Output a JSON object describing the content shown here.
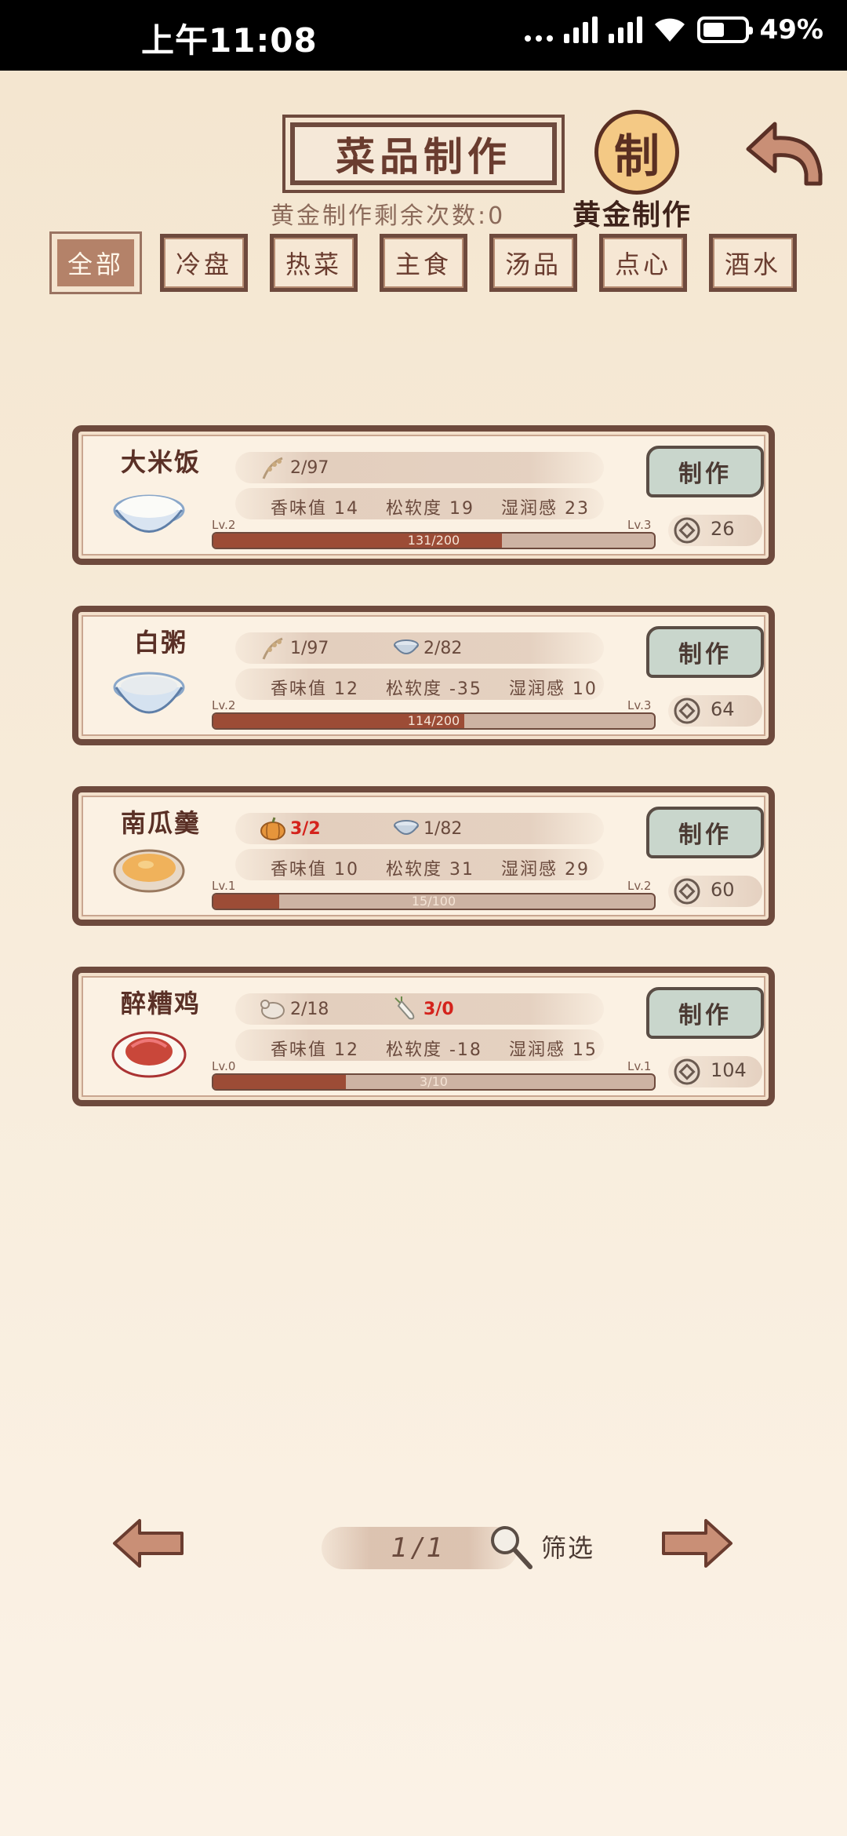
{
  "status": {
    "time": "上午11:08",
    "battery": "49%"
  },
  "header": {
    "title": "菜品制作",
    "gold_remaining": "黄金制作剩余次数:0",
    "gold_seal_char": "制",
    "gold_label": "黄金制作"
  },
  "tabs": [
    {
      "label": "全部",
      "active": true
    },
    {
      "label": "冷盘",
      "active": false
    },
    {
      "label": "热菜",
      "active": false
    },
    {
      "label": "主食",
      "active": false
    },
    {
      "label": "汤品",
      "active": false
    },
    {
      "label": "点心",
      "active": false
    },
    {
      "label": "酒水",
      "active": false
    }
  ],
  "recipes": [
    {
      "name": "大米饭",
      "ingredients": [
        {
          "icon": "rice-stalk-icon",
          "value": "2/97",
          "insufficient": false
        }
      ],
      "stats": {
        "aroma": "香味值 14",
        "softness": "松软度 19",
        "moisture": "湿润感 23"
      },
      "level": "Lv.2",
      "next_level": "Lv.3",
      "progress_text": "131/200",
      "progress": 0.655,
      "make_label": "制作",
      "cost": "26"
    },
    {
      "name": "白粥",
      "ingredients": [
        {
          "icon": "rice-stalk-icon",
          "value": "1/97",
          "insufficient": false
        },
        {
          "icon": "water-bowl-icon",
          "value": "2/82",
          "insufficient": false
        }
      ],
      "stats": {
        "aroma": "香味值 12",
        "softness": "松软度 -35",
        "moisture": "湿润感 10"
      },
      "level": "Lv.2",
      "next_level": "Lv.3",
      "progress_text": "114/200",
      "progress": 0.57,
      "make_label": "制作",
      "cost": "64"
    },
    {
      "name": "南瓜羹",
      "ingredients": [
        {
          "icon": "pumpkin-icon",
          "value": "3/2",
          "insufficient": true
        },
        {
          "icon": "water-bowl-icon",
          "value": "1/82",
          "insufficient": false
        }
      ],
      "stats": {
        "aroma": "香味值 10",
        "softness": "松软度 31",
        "moisture": "湿润感 29"
      },
      "level": "Lv.1",
      "next_level": "Lv.2",
      "progress_text": "15/100",
      "progress": 0.15,
      "make_label": "制作",
      "cost": "60"
    },
    {
      "name": "醉糟鸡",
      "ingredients": [
        {
          "icon": "chicken-icon",
          "value": "2/18",
          "insufficient": false
        },
        {
          "icon": "radish-icon",
          "value": "3/0",
          "insufficient": true
        }
      ],
      "stats": {
        "aroma": "香味值 12",
        "softness": "松软度 -18",
        "moisture": "湿润感 15"
      },
      "level": "Lv.0",
      "next_level": "Lv.1",
      "progress_text": "3/10",
      "progress": 0.3,
      "make_label": "制作",
      "cost": "104"
    }
  ],
  "footer": {
    "page": "1/1",
    "filter_label": "筛选"
  },
  "colors": {
    "frame": "#6e4a3d",
    "progress_fill": "#9c4c36",
    "red_warning": "#d4231c",
    "button_green": "#c9d6cc"
  }
}
